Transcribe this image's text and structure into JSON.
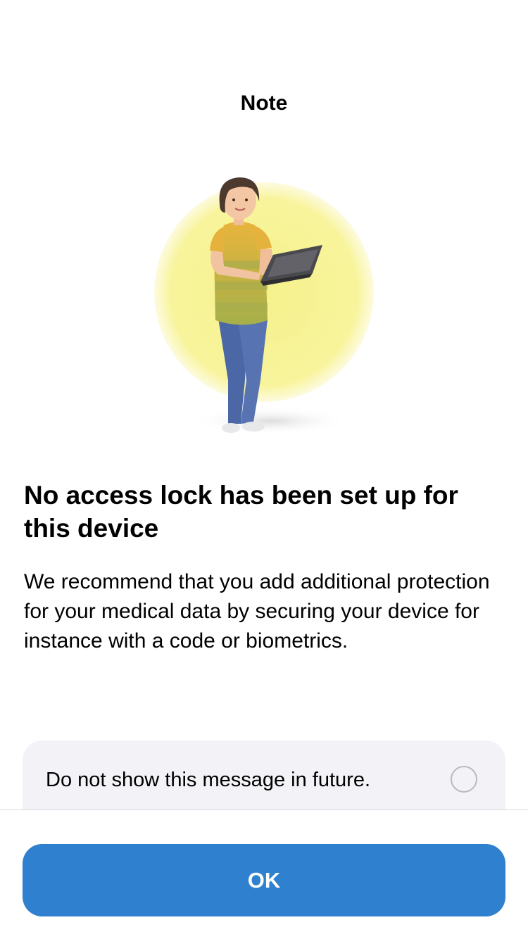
{
  "header": {
    "title": "Note"
  },
  "illustration": {
    "icon": "woman-with-laptop-illustration",
    "accent_color": "#f7f296"
  },
  "content": {
    "headline": "No access lock has been set up for this device",
    "body": "We recommend that you add additional protection for your medical data by securing your device for instance with a code or biometrics."
  },
  "option": {
    "label": "Do not show this message in future.",
    "checked": false
  },
  "footer": {
    "ok_label": "OK",
    "button_color": "#2f80ce"
  }
}
